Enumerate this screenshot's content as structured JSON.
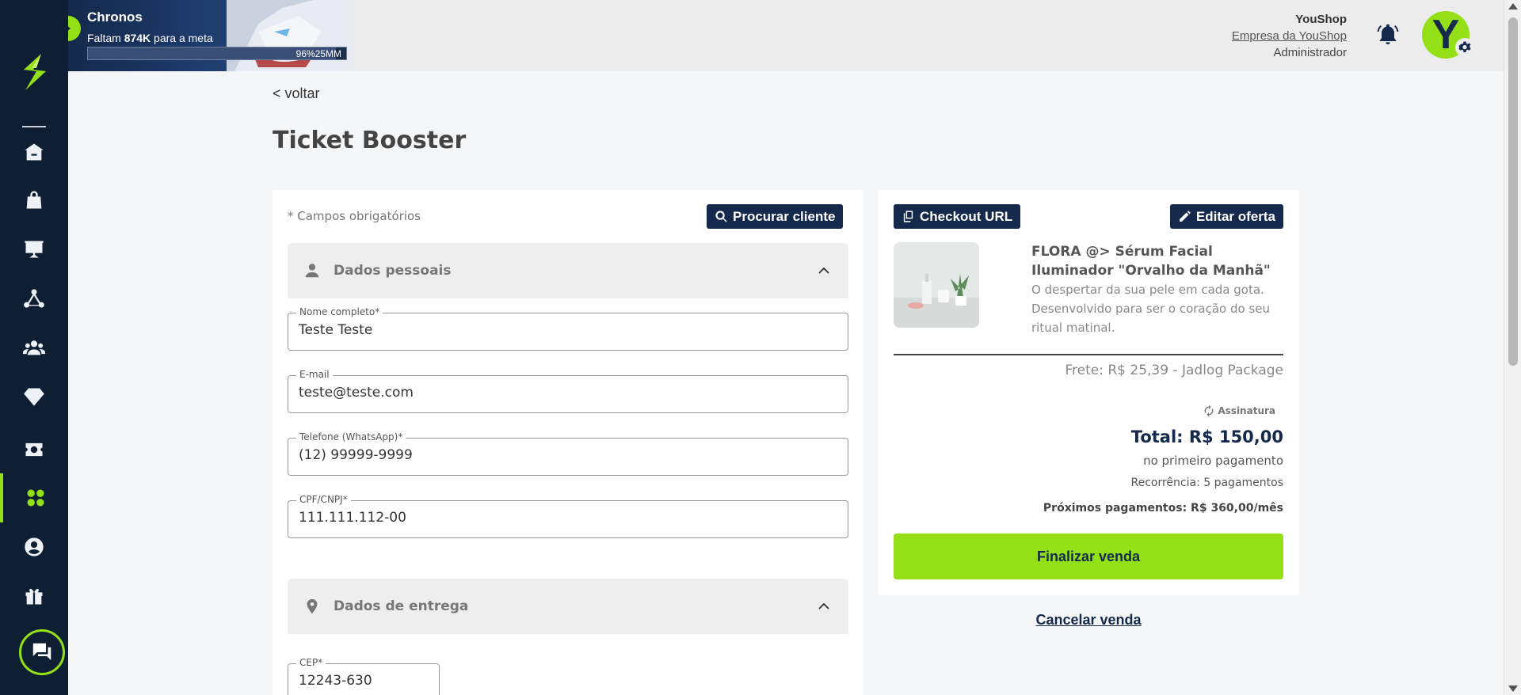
{
  "banner": {
    "title": "Chronos",
    "subtitle_prefix": "Faltam ",
    "subtitle_amount": "874K",
    "subtitle_suffix": " para a meta",
    "progress_text": "96%25MM",
    "progress_value": 0.96
  },
  "header": {
    "shop_name": "YouShop",
    "company": "Empresa da YouShop",
    "role": "Administrador",
    "avatar_letter": "Y"
  },
  "sidebar": {
    "items": [
      {
        "icon": "home-icon"
      },
      {
        "icon": "bag-icon"
      },
      {
        "icon": "presentation-chart-icon"
      },
      {
        "icon": "network-icon"
      },
      {
        "icon": "users-group-icon"
      },
      {
        "icon": "diamond-icon"
      },
      {
        "icon": "ticket-icon"
      },
      {
        "icon": "apps-grid-icon",
        "active": true
      },
      {
        "icon": "account-circle-icon"
      },
      {
        "icon": "gift-icon"
      }
    ],
    "chat_icon": "chat-icon"
  },
  "page": {
    "back_label": "< voltar",
    "title": "Ticket Booster"
  },
  "form": {
    "required_note": "* Campos obrigatórios",
    "search_button": "Procurar cliente",
    "personal_section": "Dados pessoais",
    "delivery_section": "Dados de entrega",
    "fields": {
      "name_label": "Nome completo*",
      "name_value": "Teste Teste",
      "email_label": "E-mail",
      "email_value": "teste@teste.com",
      "phone_label": "Telefone (WhatsApp)*",
      "phone_value": "(12) 99999-9999",
      "doc_label": "CPF/CNPJ*",
      "doc_value": "111.111.112-00",
      "cep_label": "CEP*",
      "cep_value": "12243-630"
    }
  },
  "order": {
    "checkout_button": "Checkout URL",
    "edit_button": "Editar oferta",
    "product_title": "FLORA @> Sérum Facial Iluminador \"Orvalho da Manhã\"",
    "product_desc": "O despertar da sua pele em cada gota. Desenvolvido para ser o coração do seu ritual matinal.",
    "shipping": "Frete: R$ 25,39 - Jadlog Package",
    "subscription_label": "Assinatura",
    "total": "Total: R$ 150,00",
    "first_payment": "no primeiro pagamento",
    "recurrence": "Recorrência: 5 pagamentos",
    "next_payments": "Próximos pagamentos: R$ 360,00/mês",
    "finalize_button": "Finalizar venda",
    "cancel_link": "Cancelar venda"
  },
  "colors": {
    "navy": "#14294b",
    "sidebar": "#0f1f33",
    "accent_green": "#94e016"
  }
}
